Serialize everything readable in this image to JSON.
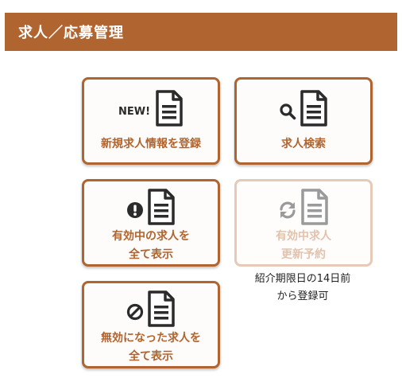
{
  "header": {
    "title": "求人／応募管理"
  },
  "cards": {
    "register": {
      "badge": "NEW!",
      "label": "新規求人情報を登録"
    },
    "search": {
      "label": "求人検索"
    },
    "active": {
      "label_line1": "有効中の求人を",
      "label_line2": "全て表示"
    },
    "renew": {
      "label_line1": "有効中求人",
      "label_line2": "更新予約"
    },
    "inactive": {
      "label_line1": "無効になった求人を",
      "label_line2": "全て表示"
    }
  },
  "note": {
    "line1": "紹介期限日の14日前",
    "line2": "から登録可"
  },
  "colors": {
    "brand": "#b0642f",
    "disabled": "#e2c2ad",
    "icon": "#2b2b2b"
  }
}
